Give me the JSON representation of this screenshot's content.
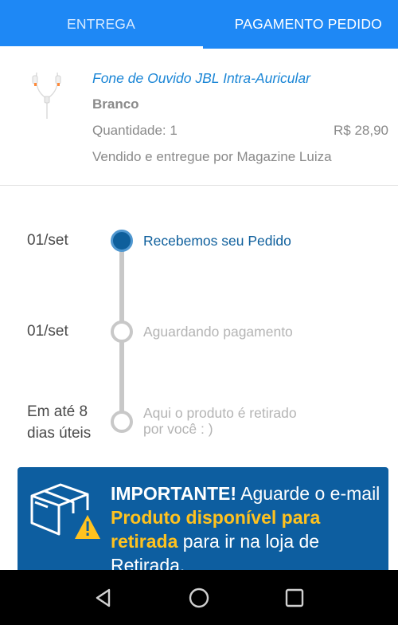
{
  "tabs": [
    {
      "label": "ENTREGA",
      "selected": false
    },
    {
      "label": "PAGAMENTO PEDIDO",
      "selected": true
    }
  ],
  "product": {
    "name": "Fone de Ouvido JBL Intra-Auricular",
    "color": "Branco",
    "quantity": "Quantidade: 1",
    "price": "R$ 28,90",
    "seller": "Vendido e entregue por Magazine Luiza",
    "thumbnail_icon": "earphones-thumbnail"
  },
  "timeline": [
    {
      "date": "01/set",
      "status": "Recebemos seu Pedido",
      "active": true
    },
    {
      "date": "01/set",
      "status": "Aguardando pagamento",
      "active": false
    },
    {
      "date_line1": "Em até 8",
      "date_line2": "dias úteis",
      "status_line1": "Aqui o produto é retirado",
      "status_line2": "por você : )",
      "active": false
    }
  ],
  "banner": {
    "icon": "package-warning-icon",
    "strong": "IMPORTANTE!",
    "text1": " Aguarde o e-mail ",
    "highlight": "Produto disponível para retirada",
    "text2": " para ir na loja de Retirada."
  },
  "colors": {
    "primary": "#1e88f5",
    "active_step": "#0e5f9c",
    "banner_bg": "#0d5ea0",
    "highlight": "#ffc21f"
  },
  "navbar": {
    "icons": [
      "back-icon",
      "home-icon",
      "recents-icon"
    ]
  }
}
